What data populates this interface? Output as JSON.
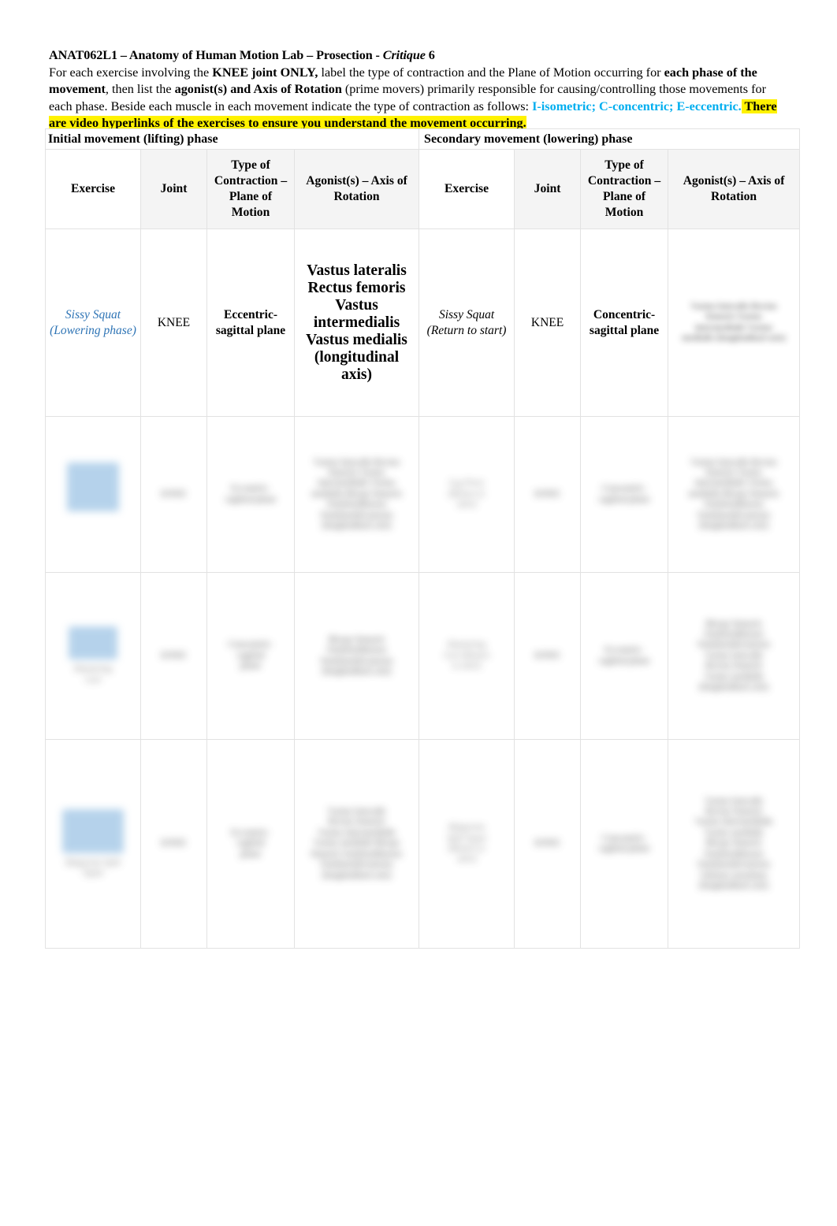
{
  "document": {
    "title_parts": {
      "code_and_course": "ANAT062L1 – Anatomy of Human Motion Lab – Prosection - ",
      "critique_word": "Critique",
      "critique_number": " 6"
    },
    "instructions": {
      "seg1": "For each exercise involving the ",
      "seg2_bold": "KNEE joint ONLY,",
      "seg3": " label the type of contraction and the Plane of Motion occurring for ",
      "seg4_bold": "each phase of the movement",
      "seg5": ", then list the ",
      "seg6_bold": "agonist(s) and Axis of Rotation",
      "seg7": " (prime movers) primarily responsible for causing/controlling those movements for each phase. Beside each muscle in each movement indicate the type of contraction as follows: ",
      "seg8_cyan": "I-isometric; C-concentric; E-eccentric.",
      "seg9_highlight": " There are video hyperlinks of the exercises to ensure you understand the movement occurring."
    }
  },
  "table": {
    "phase_banners": {
      "initial": "Initial movement (lifting) phase",
      "secondary": "Secondary movement (lowering) phase"
    },
    "columns": [
      {
        "key": "exercise_1",
        "label": "Exercise"
      },
      {
        "key": "joint_1",
        "label": "Joint"
      },
      {
        "key": "type_1",
        "label": "Type of Contraction – Plane of Motion"
      },
      {
        "key": "agonist_1",
        "label": "Agonist(s) – Axis of Rotation"
      },
      {
        "key": "exercise_2",
        "label": "Exercise"
      },
      {
        "key": "joint_2",
        "label": "Joint"
      },
      {
        "key": "type_2",
        "label": "Type of Contraction – Plane of Motion"
      },
      {
        "key": "agonist_2",
        "label": "Agonist(s) – Axis of Rotation"
      }
    ],
    "rows": [
      {
        "redacted": false,
        "exercise_1": "Sissy Squat (Lowering phase)",
        "joint_1": "KNEE",
        "type_1": "Eccentric- sagittal plane",
        "agonist_1": "Vastus lateralis Rectus femoris Vastus intermedialis Vastus medialis (longitudinal axis)",
        "exercise_2": "Sissy Squat (Return to start)",
        "joint_2": "KNEE",
        "type_2": "Concentric- sagittal plane",
        "agonist_2": ""
      },
      {
        "redacted": true
      },
      {
        "redacted": true
      },
      {
        "redacted": true
      }
    ]
  },
  "colors": {
    "highlight_yellow": "#FFF200",
    "cyan_text": "#00AEEF",
    "hyperlink_blue": "#2E74B5",
    "header_fill": "#EBEBEB",
    "grid_line": "#E2E2E2",
    "thumbnail_blue": "#A9CBE8"
  }
}
